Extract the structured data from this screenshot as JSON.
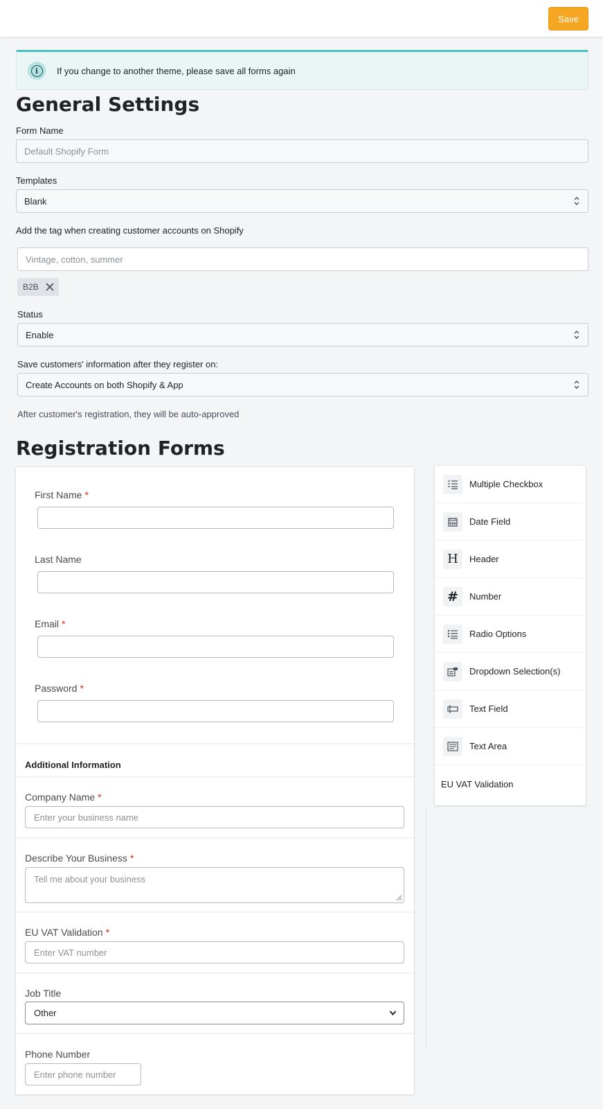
{
  "toolbar": {
    "save_label": "Save"
  },
  "banner": {
    "text": "If you change to another theme, please save all forms again",
    "icon": "info-icon"
  },
  "general": {
    "title": "General Settings",
    "form_name_label": "Form Name",
    "form_name_placeholder": "Default Shopify Form",
    "templates_label": "Templates",
    "templates_value": "Blank",
    "tag_label": "Add the tag when creating customer accounts on Shopify",
    "tag_placeholder": "Vintage, cotton, summer",
    "tags": [
      "B2B"
    ],
    "status_label": "Status",
    "status_value": "Enable",
    "save_on_label": "Save customers' information after they register on:",
    "save_on_value": "Create Accounts on both Shopify & App",
    "note": "After customer's registration, they will be auto-approved"
  },
  "registration": {
    "title": "Registration Forms",
    "fields": [
      {
        "label": "First Name",
        "required": "*"
      },
      {
        "label": "Last Name",
        "required": ""
      },
      {
        "label": "Email",
        "required": "*"
      },
      {
        "label": "Password",
        "required": "*"
      }
    ],
    "additional_title": "Additional Information",
    "additional": {
      "company_label": "Company Name",
      "company_placeholder": "Enter your business name",
      "describe_label": "Describe Your Business",
      "describe_placeholder": "Tell me about your business",
      "vat_label": "EU VAT Validation",
      "vat_placeholder": "Enter VAT number",
      "job_label": "Job Title",
      "job_value": "Other",
      "phone_label": "Phone Number",
      "phone_placeholder": "Enter phone number",
      "req_mark": "*"
    }
  },
  "elements": [
    {
      "label": "Multiple Checkbox",
      "icon": "checkbox-list-icon"
    },
    {
      "label": "Date Field",
      "icon": "calendar-icon"
    },
    {
      "label": "Header",
      "icon": "header-icon"
    },
    {
      "label": "Number",
      "icon": "hash-icon"
    },
    {
      "label": "Radio Options",
      "icon": "radio-list-icon"
    },
    {
      "label": "Dropdown Selection(s)",
      "icon": "dropdown-icon"
    },
    {
      "label": "Text Field",
      "icon": "text-field-icon"
    },
    {
      "label": "Text Area",
      "icon": "text-area-icon"
    },
    {
      "label": "EU VAT Validation",
      "icon": ""
    }
  ],
  "colors": {
    "accent": "#f5a623",
    "banner_border": "#47c1bf",
    "required": "#d72c0d"
  }
}
